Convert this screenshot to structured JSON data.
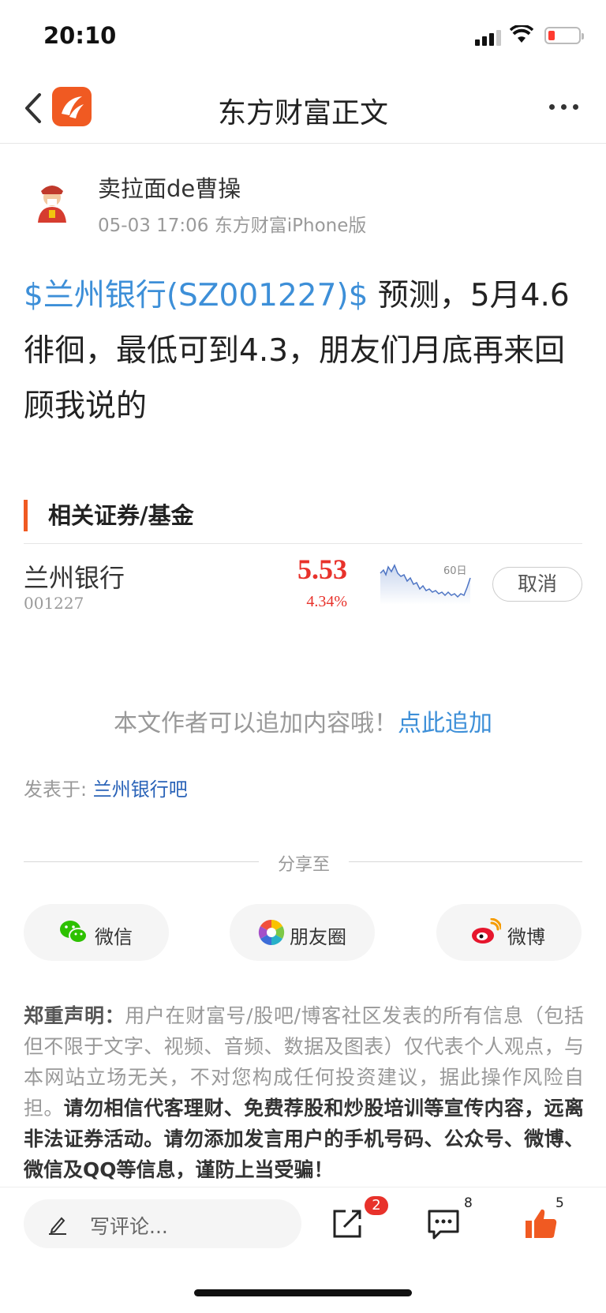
{
  "status_bar": {
    "time": "20:10"
  },
  "nav": {
    "title": "东方财富正文"
  },
  "author": {
    "name": "卖拉面de曹操",
    "meta": "05-03 17:06 东方财富iPhone版"
  },
  "article": {
    "stock_tag": "$兰州银行(SZ001227)$",
    "text": " 预测，5月4.6徘徊，最低可到4.3，朋友们月底再来回顾我说的"
  },
  "related": {
    "title": "相关证券/基金",
    "stock": {
      "name": "兰州银行",
      "code": "001227",
      "price": "5.53",
      "change": "4.34%",
      "chart_label": "60日",
      "cancel_label": "取消"
    }
  },
  "append": {
    "text": "本文作者可以追加内容哦！",
    "link": "点此追加"
  },
  "posted_in": {
    "label": "发表于: ",
    "bar": "兰州银行吧"
  },
  "share": {
    "label": "分享至",
    "buttons": [
      {
        "label": "微信",
        "icon": "wechat-icon"
      },
      {
        "label": "朋友圈",
        "icon": "moments-icon"
      },
      {
        "label": "微博",
        "icon": "weibo-icon"
      }
    ]
  },
  "disclaimer": {
    "head": "郑重声明：",
    "normal": "用户在财富号/股吧/博客社区发表的所有信息（包括但不限于文字、视频、音频、数据及图表）仅代表个人观点，与本网站立场无关，不对您构成任何投资建议，据此操作风险自担。",
    "strong": "请勿相信代客理财、免费荐股和炒股培训等宣传内容，远离非法证券活动。请勿添加发言用户的手机号码、公众号、微博、微信及QQ等信息，谨防上当受骗！"
  },
  "toolbar": {
    "comment_placeholder": "写评论...",
    "share_badge": "2",
    "comment_count": "8",
    "like_count": "5"
  },
  "colors": {
    "accent": "#f05a22",
    "link": "#3d8fd8",
    "up": "#e8322b"
  }
}
